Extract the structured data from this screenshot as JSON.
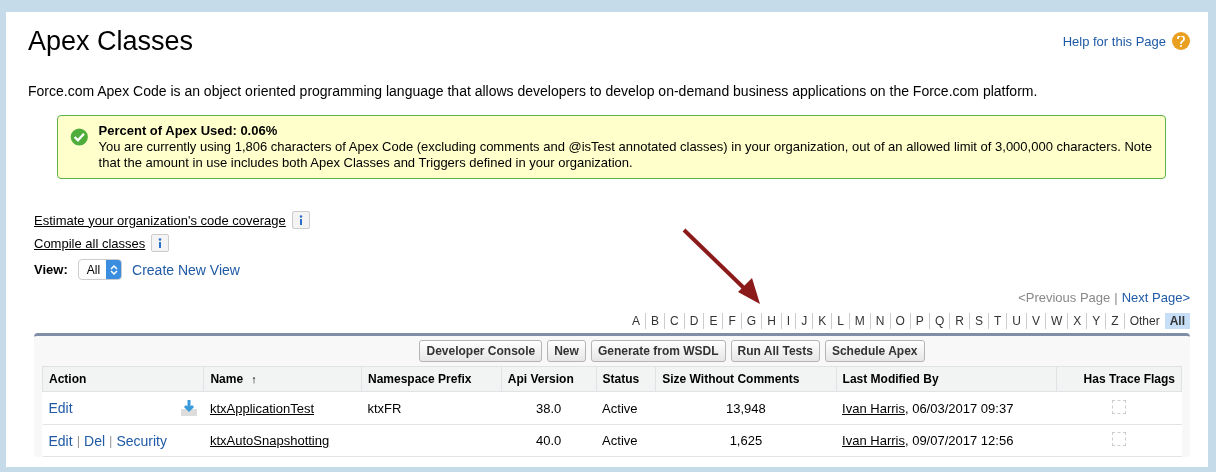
{
  "page": {
    "title": "Apex Classes",
    "help_link": "Help for this Page",
    "description": "Force.com Apex Code is an object oriented programming language that allows developers to develop on-demand business applications on the Force.com platform."
  },
  "notice": {
    "heading": "Percent of Apex Used: 0.06%",
    "body": "You are currently using 1,806 characters of Apex Code (excluding comments and @isTest annotated classes) in your organization, out of an allowed limit of 3,000,000 characters. Note that the amount in use includes both Apex Classes and Triggers defined in your organization."
  },
  "links": [
    {
      "label": "Estimate your organization's code coverage"
    },
    {
      "label": "Compile all classes"
    }
  ],
  "view": {
    "label": "View:",
    "value": "All",
    "create_link": "Create New View"
  },
  "pager": {
    "previous": "<Previous Page",
    "separator": "|",
    "next": "Next Page>"
  },
  "letters": [
    {
      "label": "A",
      "selected": false
    },
    {
      "label": "B",
      "selected": false
    },
    {
      "label": "C",
      "selected": false
    },
    {
      "label": "D",
      "selected": false
    },
    {
      "label": "E",
      "selected": false
    },
    {
      "label": "F",
      "selected": false
    },
    {
      "label": "G",
      "selected": false
    },
    {
      "label": "H",
      "selected": false
    },
    {
      "label": "I",
      "selected": false
    },
    {
      "label": "J",
      "selected": false
    },
    {
      "label": "K",
      "selected": false
    },
    {
      "label": "L",
      "selected": false
    },
    {
      "label": "M",
      "selected": false
    },
    {
      "label": "N",
      "selected": false
    },
    {
      "label": "O",
      "selected": false
    },
    {
      "label": "P",
      "selected": false
    },
    {
      "label": "Q",
      "selected": false
    },
    {
      "label": "R",
      "selected": false
    },
    {
      "label": "S",
      "selected": false
    },
    {
      "label": "T",
      "selected": false
    },
    {
      "label": "U",
      "selected": false
    },
    {
      "label": "V",
      "selected": false
    },
    {
      "label": "W",
      "selected": false
    },
    {
      "label": "X",
      "selected": false
    },
    {
      "label": "Y",
      "selected": false
    },
    {
      "label": "Z",
      "selected": false
    },
    {
      "label": "Other",
      "selected": false
    },
    {
      "label": "All",
      "selected": true
    }
  ],
  "toolbar": [
    "Developer Console",
    "New",
    "Generate from WSDL",
    "Run All Tests",
    "Schedule Apex"
  ],
  "table": {
    "columns": [
      "Action",
      "Name",
      "Namespace Prefix",
      "Api Version",
      "Status",
      "Size Without Comments",
      "Last Modified By",
      "Has Trace Flags"
    ],
    "sort_mark": "↑",
    "action_separator": "|",
    "rows": [
      {
        "actions": [
          "Edit"
        ],
        "download": true,
        "name": "ktxApplicationTest",
        "namespace": "ktxFR",
        "api_version": "38.0",
        "status": "Active",
        "size": "13,948",
        "modified_by": "Ivan Harris",
        "modified_at": ", 06/03/2017 09:37",
        "trace_flags": false
      },
      {
        "actions": [
          "Edit",
          "Del",
          "Security"
        ],
        "download": false,
        "name": "ktxAutoSnapshotting",
        "namespace": "",
        "api_version": "40.0",
        "status": "Active",
        "size": "1,625",
        "modified_by": "Ivan Harris",
        "modified_at": ", 09/07/2017 12:56",
        "trace_flags": false
      }
    ]
  }
}
